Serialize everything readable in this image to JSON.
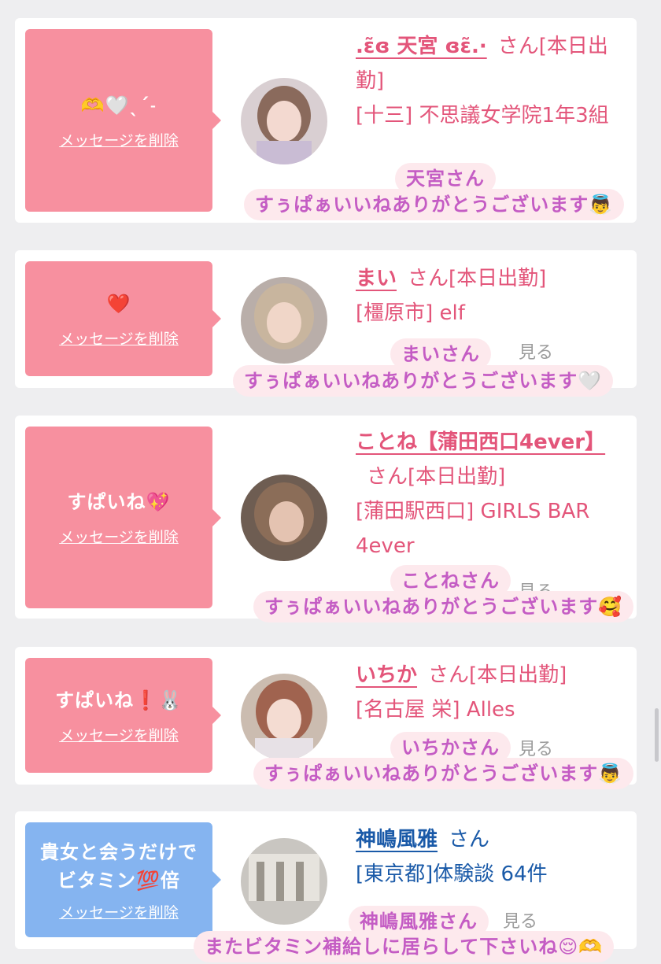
{
  "common": {
    "delete_label": "メッセージを削除",
    "san_label": "さん[本日出勤]",
    "san_only": "さん",
    "view_label": "見る"
  },
  "cards": [
    {
      "message": "🫶🤍ˎˊ˗",
      "name": ".ɛ̃ɞ 天宮 ɞɛ̃.·",
      "location": "[十三] 不思議女学院1年3組",
      "overlay_name": "天宮さん",
      "overlay_text": "すぅぱぁいいねありがとうございます👼"
    },
    {
      "message": "❤️",
      "name": "まい",
      "location": "[橿原市] elf",
      "overlay_name": "まいさん",
      "overlay_text": "すぅぱぁいいねありがとうございます🤍"
    },
    {
      "message": "すぱいね💖",
      "name": "ことね【蒲田西口4ever】",
      "location": "[蒲田駅西口] GIRLS BAR 4ever",
      "overlay_name": "ことねさん",
      "overlay_text": "すぅぱぁいいねありがとうございます🥰"
    },
    {
      "message": "すぱいね❗️🐰",
      "name": "いちか",
      "location": "[名古屋 栄] Alles",
      "overlay_name": "いちかさん",
      "overlay_text": "すぅぱぁいいねありがとうございます👼"
    },
    {
      "message": "貴女と会うだけでビタミン💯倍",
      "name": "神嶋風雅",
      "location": "[東京都]体験談 64件",
      "overlay_name": "神嶋風雅さん",
      "overlay_text": "またビタミン補給しに居らして下さいね😌🫶"
    }
  ],
  "colors": {
    "pink": "#f7909f",
    "blue": "#85b4f0",
    "name_pink": "#e3557a",
    "name_blue": "#1a5aa8",
    "overlay_bg": "#fde9ed",
    "overlay_text": "#c45cc4"
  }
}
